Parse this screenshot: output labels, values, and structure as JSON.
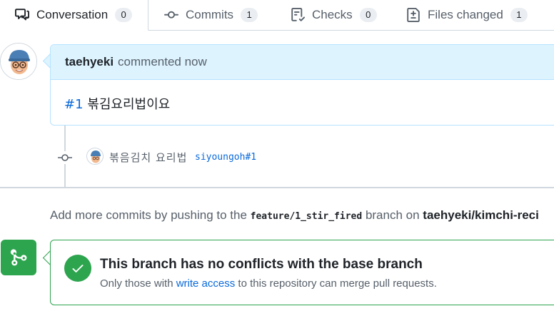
{
  "tabs": [
    {
      "label": "Conversation",
      "count": "0",
      "icon": "comment-discussion-icon",
      "selected": true
    },
    {
      "label": "Commits",
      "count": "1",
      "icon": "git-commit-icon",
      "selected": false
    },
    {
      "label": "Checks",
      "count": "0",
      "icon": "checklist-icon",
      "selected": false
    },
    {
      "label": "Files changed",
      "count": "1",
      "icon": "file-diff-icon",
      "selected": false
    }
  ],
  "comment": {
    "author": "taehyeki",
    "action": "commented now",
    "ref": "#1",
    "body": "볶김요리법이요"
  },
  "commit": {
    "message": "볶음김치 요리법",
    "author_ref": "siyoungoh#1"
  },
  "push_note": {
    "prefix": "Add more commits by pushing to the",
    "branch": "feature/1_stir_fired",
    "middle": "branch on",
    "repo": "taehyeki/kimchi-reci"
  },
  "merge": {
    "title": "This branch has no conflicts with the base branch",
    "sub_prefix": "Only those with",
    "sub_link": "write access",
    "sub_suffix": "to this repository can merge pull requests."
  },
  "colors": {
    "accent": "#0969da",
    "success": "#2da44e",
    "comment_header": "#ddf4ff"
  }
}
